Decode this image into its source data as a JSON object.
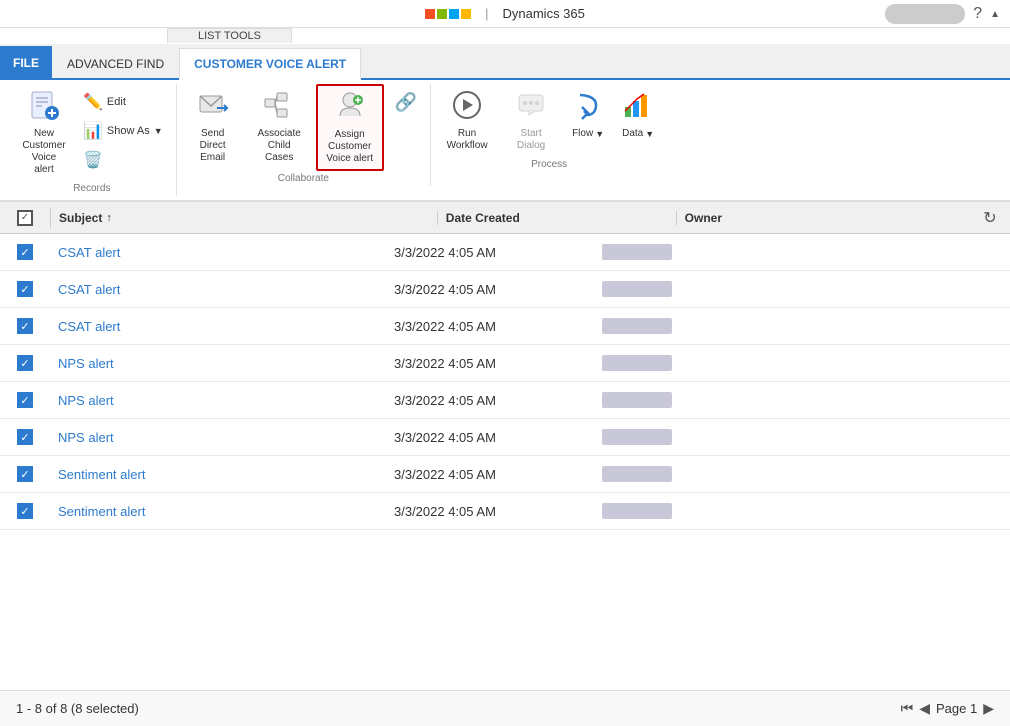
{
  "topbar": {
    "app_title": "Dynamics 365",
    "separator": "|"
  },
  "ribbon": {
    "tabs": [
      {
        "id": "file",
        "label": "FILE",
        "type": "file"
      },
      {
        "id": "advanced-find",
        "label": "ADVANCED FIND",
        "type": "normal"
      },
      {
        "id": "customer-voice-alert",
        "label": "CUSTOMER VOICE ALERT",
        "type": "active"
      }
    ],
    "list_tools_header": "LIST TOOLS",
    "groups": [
      {
        "id": "records",
        "label": "Records",
        "buttons": [
          {
            "id": "new-customer",
            "label": "New Customer Voice alert",
            "icon": "📋"
          },
          {
            "id": "edit",
            "label": "Edit",
            "icon": "✏️"
          },
          {
            "id": "show-as",
            "label": "Show As",
            "icon": "📊",
            "dropdown": true
          },
          {
            "id": "delete",
            "label": "",
            "icon": "🗑️",
            "small": true
          }
        ]
      },
      {
        "id": "collaborate",
        "label": "Collaborate",
        "buttons": [
          {
            "id": "send-direct-email",
            "label": "Send Direct Email",
            "icon": "✉️"
          },
          {
            "id": "associate-child-cases",
            "label": "Associate Child Cases",
            "icon": "🔗",
            "highlighted": false
          },
          {
            "id": "assign-customer-voice",
            "label": "Assign Customer Voice alert",
            "icon": "👤",
            "highlighted": true
          },
          {
            "id": "link",
            "label": "",
            "icon": "🔗",
            "small": true
          }
        ]
      },
      {
        "id": "process",
        "label": "Process",
        "buttons": [
          {
            "id": "run-workflow",
            "label": "Run Workflow",
            "icon": "▶️"
          },
          {
            "id": "start-dialog",
            "label": "Start Dialog",
            "icon": "💬"
          },
          {
            "id": "flow",
            "label": "Flow",
            "icon": "🌊",
            "dropdown": true
          },
          {
            "id": "data",
            "label": "Data",
            "icon": "📈",
            "dropdown": true
          }
        ]
      }
    ]
  },
  "grid": {
    "columns": [
      {
        "id": "subject",
        "label": "Subject",
        "sortable": true,
        "sort_dir": "asc"
      },
      {
        "id": "date_created",
        "label": "Date Created"
      },
      {
        "id": "owner",
        "label": "Owner"
      }
    ],
    "rows": [
      {
        "id": 1,
        "subject": "CSAT alert",
        "date": "3/3/2022 4:05 AM",
        "checked": true
      },
      {
        "id": 2,
        "subject": "CSAT alert",
        "date": "3/3/2022 4:05 AM",
        "checked": true
      },
      {
        "id": 3,
        "subject": "CSAT alert",
        "date": "3/3/2022 4:05 AM",
        "checked": true
      },
      {
        "id": 4,
        "subject": "NPS alert",
        "date": "3/3/2022 4:05 AM",
        "checked": true
      },
      {
        "id": 5,
        "subject": "NPS alert",
        "date": "3/3/2022 4:05 AM",
        "checked": true
      },
      {
        "id": 6,
        "subject": "NPS alert",
        "date": "3/3/2022 4:05 AM",
        "checked": true
      },
      {
        "id": 7,
        "subject": "Sentiment alert",
        "date": "3/3/2022 4:05 AM",
        "checked": true
      },
      {
        "id": 8,
        "subject": "Sentiment alert",
        "date": "3/3/2022 4:05 AM",
        "checked": true
      }
    ]
  },
  "statusbar": {
    "count_label": "1 - 8 of 8 (8 selected)",
    "page_label": "Page 1"
  }
}
